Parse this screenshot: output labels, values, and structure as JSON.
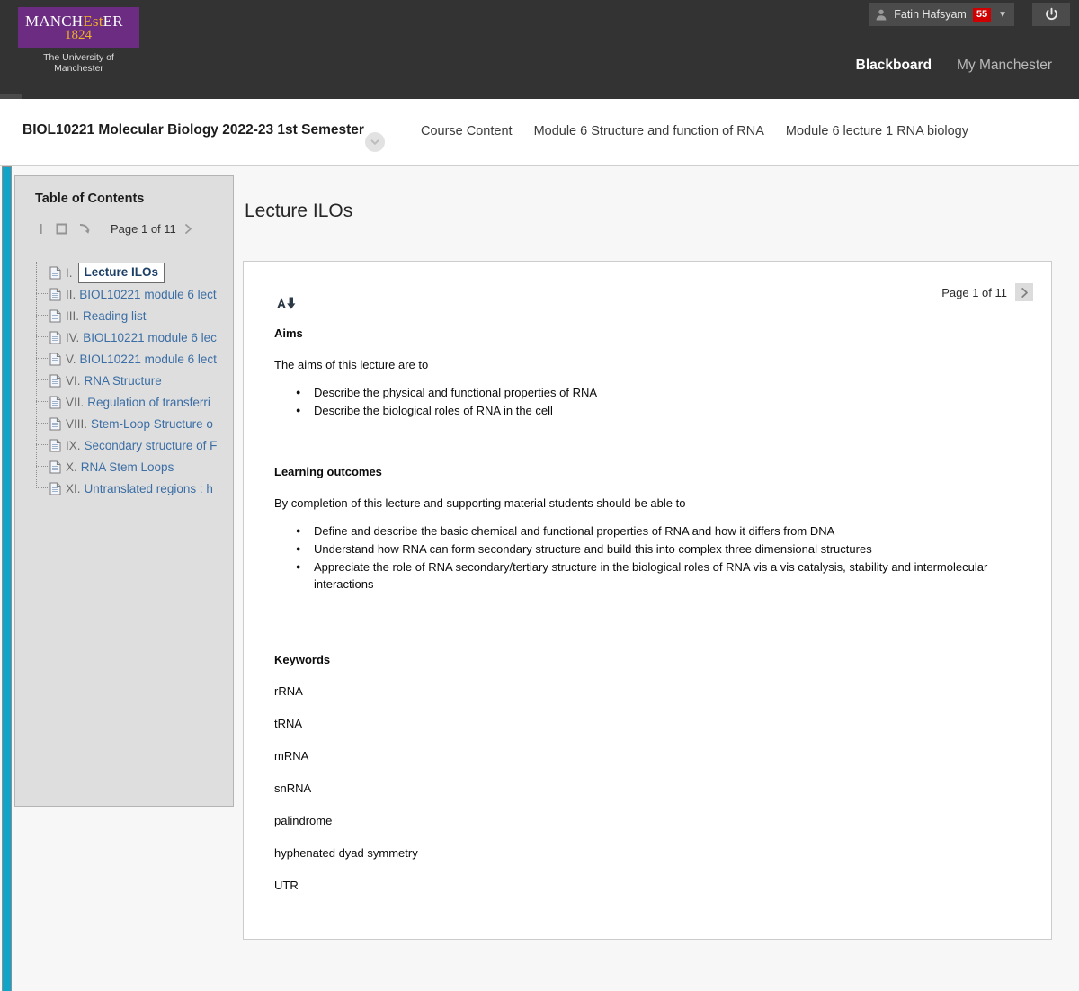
{
  "topbar": {
    "logo": {
      "word_part1": "MANCH",
      "word_est": "Est",
      "word_part2": "ER",
      "year": "1824",
      "subtitle": "The University of Manchester"
    },
    "user": {
      "name": "Fatin Hafsyam",
      "badge": "55",
      "caret": "▼"
    },
    "nav_tabs": [
      {
        "label": "Blackboard",
        "active": true
      },
      {
        "label": "My Manchester",
        "active": false
      }
    ],
    "accent_color": "#cc7fe0"
  },
  "coursebar": {
    "title": "BIOL10221 Molecular Biology 2022-23 1st Semester",
    "breadcrumb": [
      "Course Content",
      "Module 6 Structure and function of RNA",
      "Module 6 lecture 1 RNA biology"
    ]
  },
  "toc": {
    "title": "Table of Contents",
    "pager_text": "Page 1 of 11",
    "items": [
      {
        "num": "I.",
        "label": "Lecture ILOs",
        "selected": true
      },
      {
        "num": "II.",
        "label": "BIOL10221 module 6 lect",
        "selected": false
      },
      {
        "num": "III.",
        "label": "Reading list",
        "selected": false
      },
      {
        "num": "IV.",
        "label": "BIOL10221 module 6 lec",
        "selected": false
      },
      {
        "num": "V.",
        "label": "BIOL10221 module 6 lect",
        "selected": false
      },
      {
        "num": "VI.",
        "label": "RNA Structure",
        "selected": false
      },
      {
        "num": "VII.",
        "label": "Regulation of transferri",
        "selected": false
      },
      {
        "num": "VIII.",
        "label": "Stem-Loop Structure o",
        "selected": false
      },
      {
        "num": "IX.",
        "label": "Secondary structure of F",
        "selected": false
      },
      {
        "num": "X.",
        "label": "RNA Stem Loops",
        "selected": false
      },
      {
        "num": "XI.",
        "label": "Untranslated regions : h",
        "selected": false
      }
    ]
  },
  "content": {
    "page_title": "Lecture ILOs",
    "pager_text": "Page 1 of 11",
    "aims_heading": "Aims",
    "aims_intro": "The aims of this lecture are to",
    "aims_bullets": [
      "Describe the physical and functional properties of RNA",
      "Describe the biological roles of RNA in the cell"
    ],
    "outcomes_heading": "Learning outcomes",
    "outcomes_intro": "By completion of this lecture and supporting material students should be able to",
    "outcomes_bullets": [
      "Define and describe the basic chemical and functional properties of RNA and how it differs from DNA",
      "Understand how RNA can form secondary structure and build this into complex three dimensional structures",
      "Appreciate the role of RNA secondary/tertiary structure in the biological roles of RNA vis a vis catalysis, stability and intermolecular interactions"
    ],
    "keywords_heading": "Keywords",
    "keywords": [
      "rRNA",
      "tRNA",
      "mRNA",
      "snRNA",
      "palindrome",
      "hyphenated dyad symmetry",
      "UTR"
    ]
  }
}
